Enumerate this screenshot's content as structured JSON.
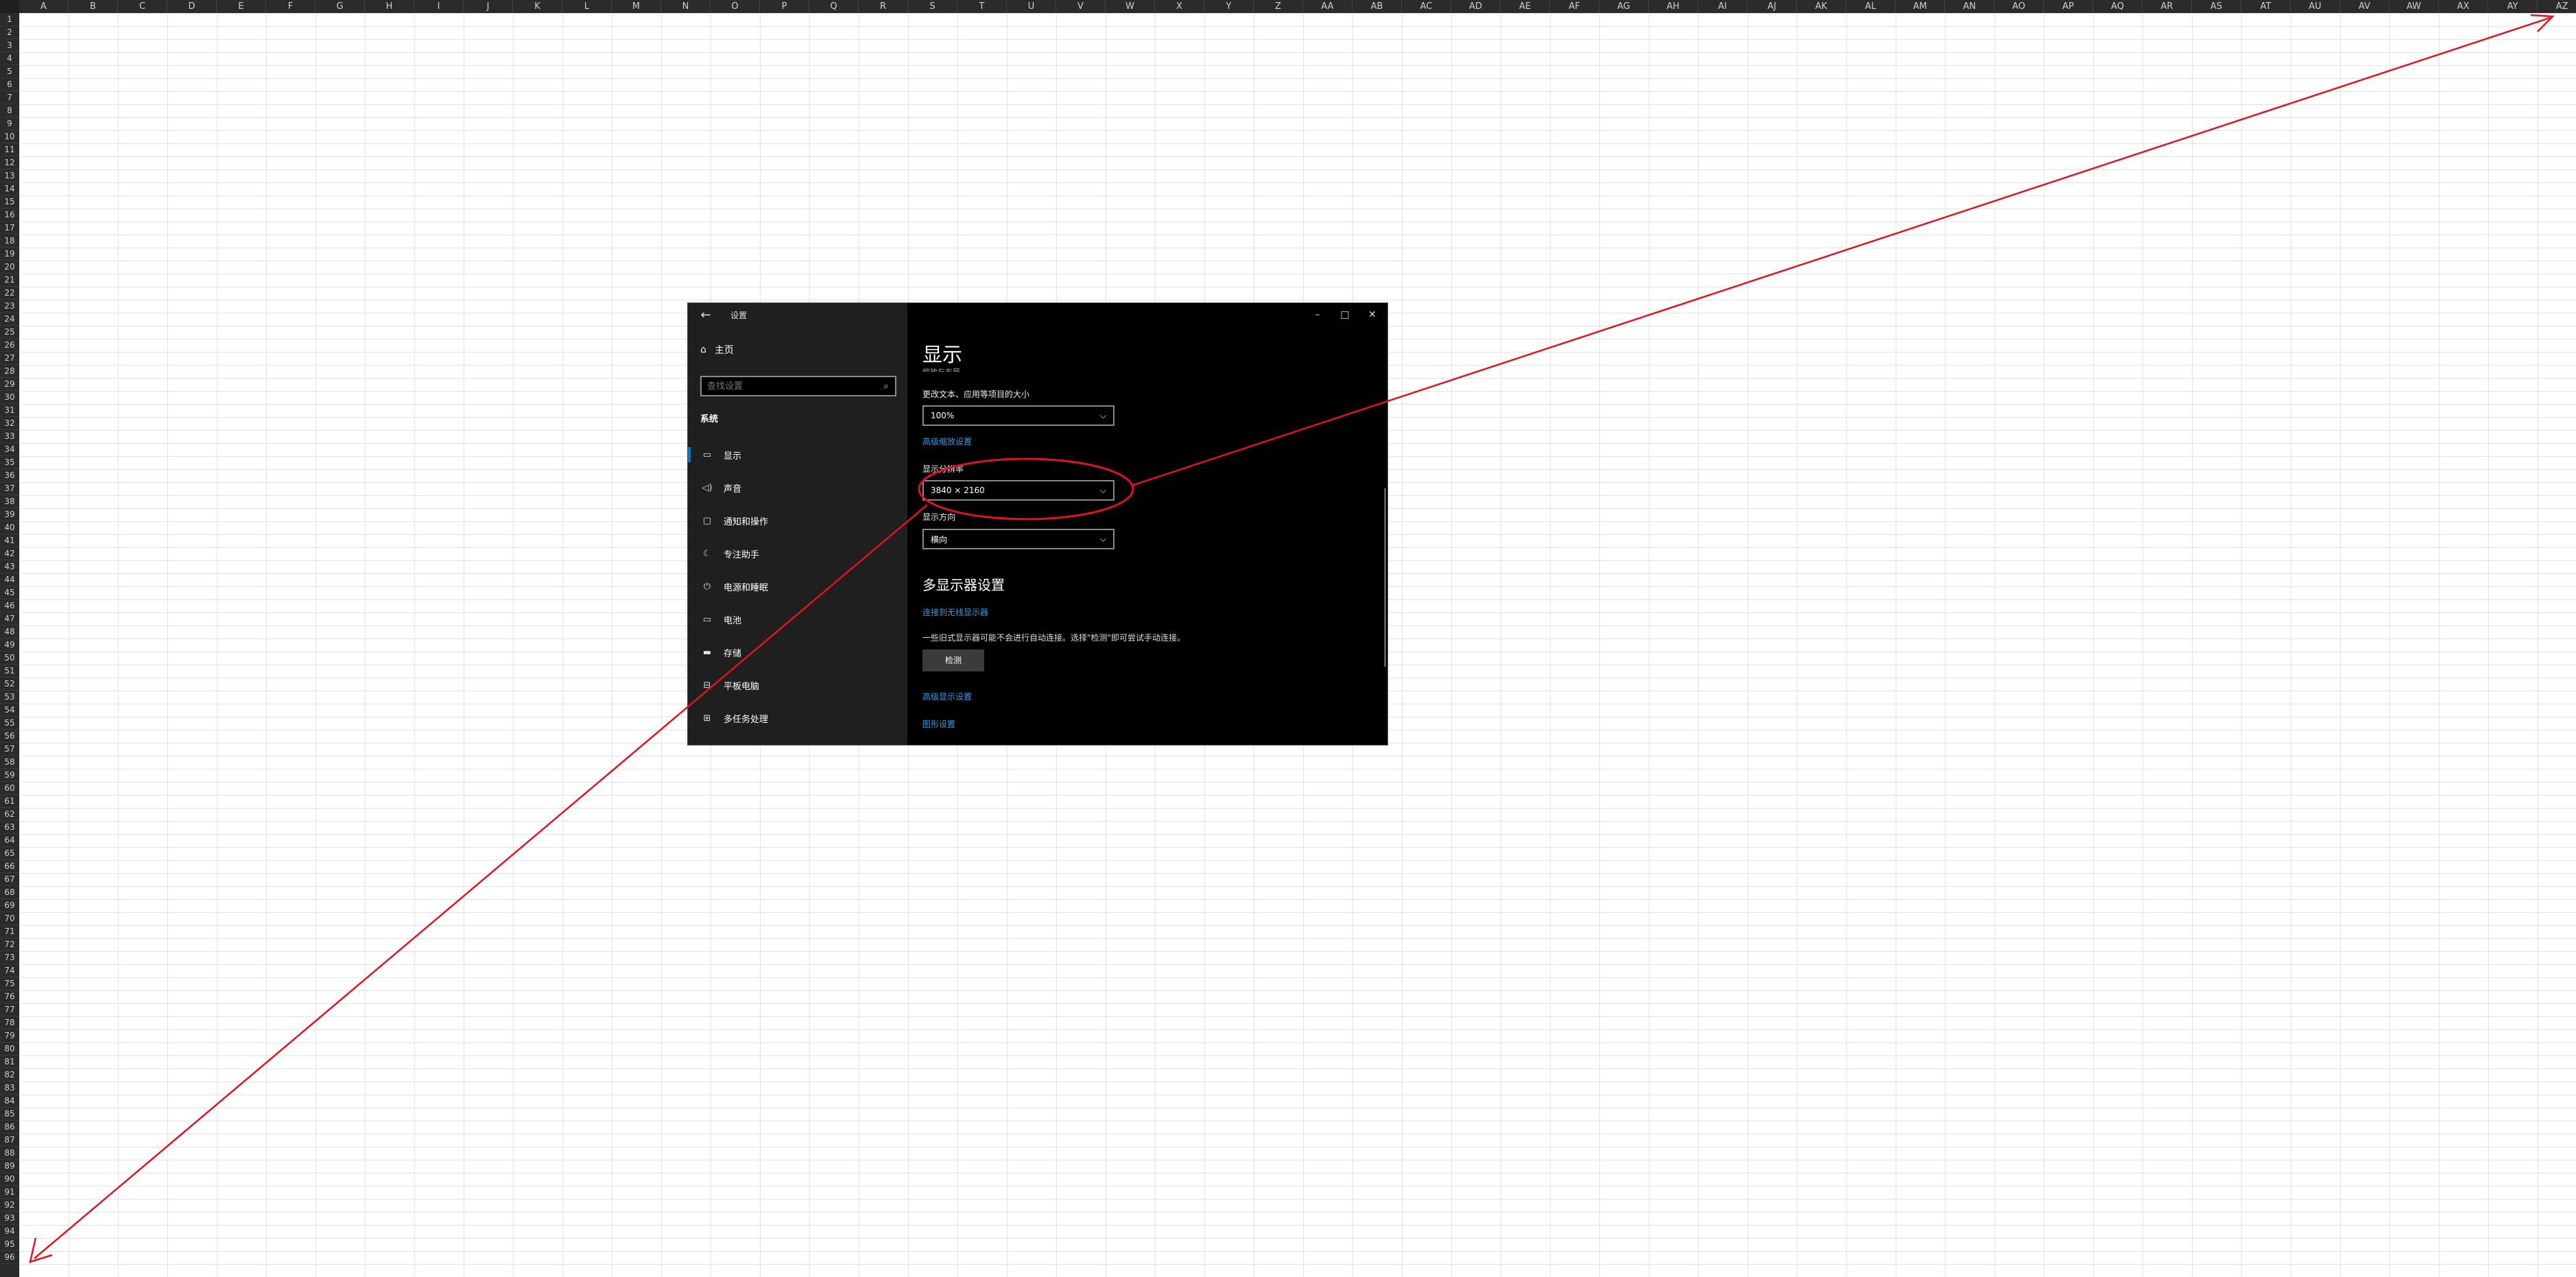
{
  "spreadsheet": {
    "columns": [
      "A",
      "B",
      "C",
      "D",
      "E",
      "F",
      "G",
      "H",
      "I",
      "J",
      "K",
      "L",
      "M",
      "N",
      "O",
      "P",
      "Q",
      "R",
      "S",
      "T",
      "U",
      "V",
      "W",
      "X",
      "Y",
      "Z",
      "AA",
      "AB",
      "AC",
      "AD",
      "AE",
      "AF",
      "AG",
      "AH",
      "AI",
      "AJ",
      "AK",
      "AL",
      "AM",
      "AN",
      "AO",
      "AP",
      "AQ",
      "AR",
      "AS",
      "AT",
      "AU",
      "AV",
      "AW",
      "AX",
      "AY",
      "AZ"
    ],
    "row_count": 96
  },
  "window": {
    "title": "设置",
    "controls": {
      "back": "←",
      "minimize": "–",
      "maximize": "□",
      "close": "✕"
    }
  },
  "sidebar": {
    "home_label": "主页",
    "search_placeholder": "查找设置",
    "section_label": "系统",
    "items": [
      {
        "label": "显示",
        "icon": "monitor-icon",
        "glyph": "▭",
        "active": true
      },
      {
        "label": "声音",
        "icon": "speaker-icon",
        "glyph": "◁)",
        "active": false
      },
      {
        "label": "通知和操作",
        "icon": "notification-icon",
        "glyph": "▢",
        "active": false
      },
      {
        "label": "专注助手",
        "icon": "moon-icon",
        "glyph": "☾",
        "active": false
      },
      {
        "label": "电源和睡眠",
        "icon": "power-icon",
        "glyph": "⏻",
        "active": false
      },
      {
        "label": "电池",
        "icon": "battery-icon",
        "glyph": "▭",
        "active": false
      },
      {
        "label": "存储",
        "icon": "storage-icon",
        "glyph": "▬",
        "active": false
      },
      {
        "label": "平板电脑",
        "icon": "tablet-icon",
        "glyph": "⊟",
        "active": false
      },
      {
        "label": "多任务处理",
        "icon": "multitask-icon",
        "glyph": "⊞",
        "active": false
      }
    ]
  },
  "main": {
    "title": "显示",
    "cut_text": "缩放与布局",
    "scale_label": "更改文本、应用等项目的大小",
    "scale_value": "100%",
    "advanced_scaling_link": "高级缩放设置",
    "resolution_label": "显示分辨率",
    "resolution_value": "3840 × 2160",
    "orientation_label": "显示方向",
    "orientation_value": "横向",
    "multi_display_heading": "多显示器设置",
    "wireless_link": "连接到无线显示器",
    "detect_note": "一些旧式显示器可能不会进行自动连接。选择\"检测\"即可尝试手动连接。",
    "detect_button": "检测",
    "advanced_display_link": "高级显示设置",
    "graphics_link": "图形设置"
  },
  "annotation": {
    "color": "#e0141e"
  }
}
